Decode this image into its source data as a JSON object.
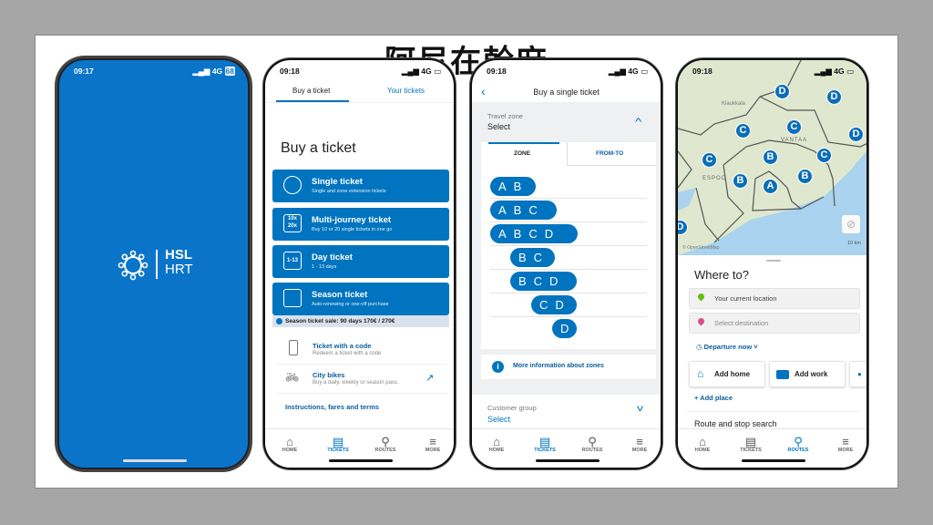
{
  "title": "阿尼在幹麻",
  "colors": {
    "brand": "#0074bf",
    "splash": "#0a74c9"
  },
  "nav": [
    {
      "label": "HOME",
      "icon": "home-icon"
    },
    {
      "label": "TICKETS",
      "icon": "tickets-icon"
    },
    {
      "label": "ROUTES",
      "icon": "routes-icon"
    },
    {
      "label": "MORE",
      "icon": "menu-icon"
    }
  ],
  "splash": {
    "time": "09:17",
    "network": "4G",
    "battery": "68",
    "logo_line1": "HSL",
    "logo_line2": "HRT"
  },
  "buy": {
    "time": "09:18",
    "network": "4G",
    "tabs": [
      "Buy a ticket",
      "Your tickets"
    ],
    "heading": "Buy a ticket",
    "tickets": [
      {
        "title": "Single ticket",
        "sub": "Single and zone extension tickets",
        "icon": "clock-icon"
      },
      {
        "title": "Multi-journey ticket",
        "sub": "Buy 10 or 20 single tickets in one go",
        "icon_text": "10x 20x"
      },
      {
        "title": "Day ticket",
        "sub": "1 - 13 days",
        "icon_text": "1-13"
      },
      {
        "title": "Season ticket",
        "sub": "Auto-renewing or one-off purchase",
        "icon": "calendar-icon"
      }
    ],
    "notice": "Season ticket sale: 90 days 170€ / 270€",
    "links": [
      {
        "title": "Ticket with a code",
        "sub": "Redeem a ticket with a code"
      },
      {
        "title": "City bikes",
        "sub": "Buy a daily, weekly or season pass."
      }
    ],
    "instructions": "Instructions, fares and terms"
  },
  "single": {
    "time": "09:18",
    "network": "4G",
    "header": "Buy a single ticket",
    "zone_label": "Travel zone",
    "zone_value": "Select",
    "tabs": [
      "ZONE",
      "FROM-TO"
    ],
    "zones": [
      "AB",
      "ABC",
      "ABCD",
      "BC",
      "BCD",
      "CD",
      "D"
    ],
    "more_info": "More information about zones",
    "group_label": "Customer group",
    "group_value": "Select"
  },
  "routes": {
    "time": "09:18",
    "network": "4G",
    "map_labels": [
      "Klaukkala",
      "VANTAA",
      "ESPOO"
    ],
    "attribution": "© OpenStreetMap",
    "scale": "10 km",
    "zones": [
      "D",
      "D",
      "D",
      "C",
      "C",
      "C",
      "C",
      "B",
      "B",
      "B",
      "A",
      "D"
    ],
    "heading": "Where to?",
    "origin": "Your current location",
    "destination_placeholder": "Select destination",
    "departure": "Departure now",
    "quick": [
      "Add home",
      "Add work"
    ],
    "add_place": "+ Add place",
    "search_heading": "Route and stop search"
  }
}
